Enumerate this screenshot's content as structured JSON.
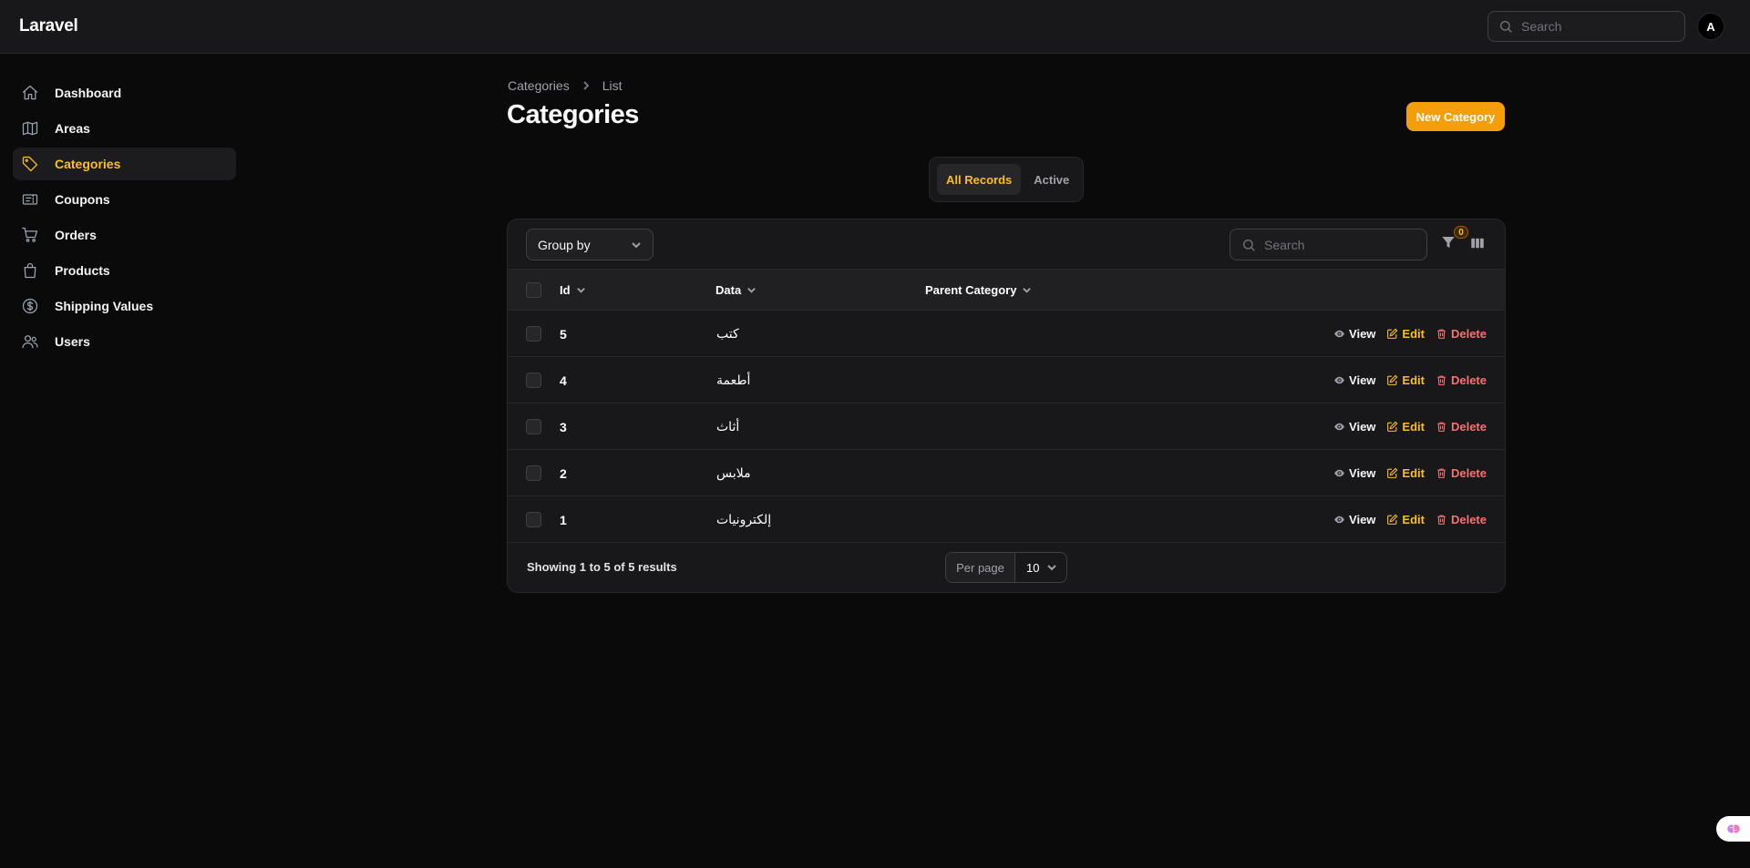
{
  "app": {
    "brand": "Laravel"
  },
  "topbar": {
    "search_placeholder": "Search",
    "avatar_initial": "A"
  },
  "sidebar": {
    "items": [
      {
        "label": "Dashboard",
        "icon": "home-icon",
        "active": false
      },
      {
        "label": "Areas",
        "icon": "map-icon",
        "active": false
      },
      {
        "label": "Categories",
        "icon": "tag-icon",
        "active": true
      },
      {
        "label": "Coupons",
        "icon": "ticket-icon",
        "active": false
      },
      {
        "label": "Orders",
        "icon": "cart-icon",
        "active": false
      },
      {
        "label": "Products",
        "icon": "shopping-bag-icon",
        "active": false
      },
      {
        "label": "Shipping Values",
        "icon": "currency-dollar-icon",
        "active": false
      },
      {
        "label": "Users",
        "icon": "users-icon",
        "active": false
      }
    ]
  },
  "header": {
    "breadcrumb": [
      "Categories",
      "List"
    ],
    "title": "Categories",
    "new_button": "New Category"
  },
  "tabs": [
    {
      "label": "All Records",
      "active": true
    },
    {
      "label": "Active",
      "active": false
    }
  ],
  "table": {
    "group_by_label": "Group by",
    "search_placeholder": "Search",
    "filter_count": "0",
    "columns": [
      "Id",
      "Data",
      "Parent Category"
    ],
    "rows": [
      {
        "id": "5",
        "data": "كتب",
        "parent": ""
      },
      {
        "id": "4",
        "data": "أطعمة",
        "parent": ""
      },
      {
        "id": "3",
        "data": "أثاث",
        "parent": ""
      },
      {
        "id": "2",
        "data": "ملابس",
        "parent": ""
      },
      {
        "id": "1",
        "data": "إلكترونيات",
        "parent": ""
      }
    ],
    "actions": {
      "view": "View",
      "edit": "Edit",
      "delete": "Delete"
    },
    "footer": {
      "results": "Showing 1 to 5 of 5 results",
      "per_page_label": "Per page",
      "per_page_value": "10"
    }
  },
  "colors": {
    "accent": "#f59e0b",
    "accent_text": "#fbbf24",
    "danger": "#f87171",
    "background": "#0a0a0b",
    "surface": "#18181b"
  }
}
